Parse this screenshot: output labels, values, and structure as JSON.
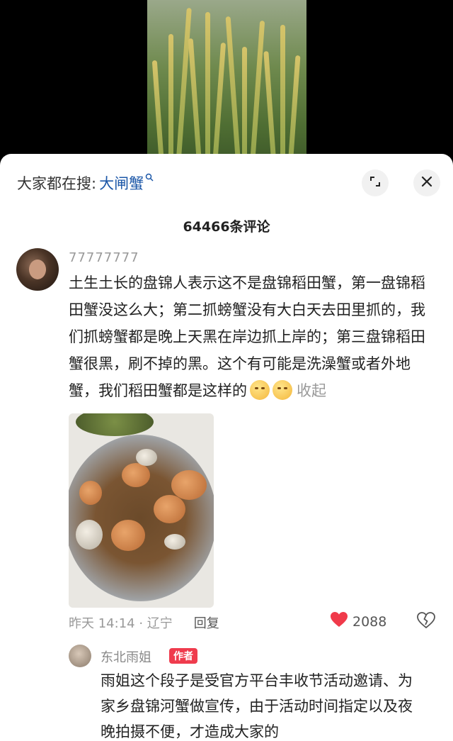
{
  "search": {
    "prefix": "大家都在搜:",
    "term": "大闸蟹",
    "term_icon": "search-icon"
  },
  "comments_header": {
    "count_label": "64466条评论"
  },
  "main_comment": {
    "username": "77777777",
    "text": "土生土长的盘锦人表示这不是盘锦稻田蟹，第一盘锦稻田蟹没这么大；第二抓螃蟹没有大白天去田里抓的，我们抓螃蟹都是晚上天黑在岸边抓上岸的；第三盘锦稻田蟹很黑，刷不掉的黑。这个有可能是洗澡蟹或者外地蟹，我们稻田蟹都是这样的",
    "emojis": [
      "smirk-emoji",
      "smirk-emoji"
    ],
    "collapse_label": "收起",
    "time_location": "昨天 14:14 · 辽宁",
    "reply_label": "回复",
    "like_count": "2088"
  },
  "reply": {
    "username": "东北雨姐",
    "badge": "作者",
    "text": "雨姐这个段子是受官方平台丰收节活动邀请、为家乡盘锦河蟹做宣传，由于活动时间指定以及夜晚拍摄不便，才造成大家的"
  },
  "colors": {
    "accent_blue": "#1c57a8",
    "like_red": "#f03a4a",
    "badge_red": "#ef3b4d"
  }
}
